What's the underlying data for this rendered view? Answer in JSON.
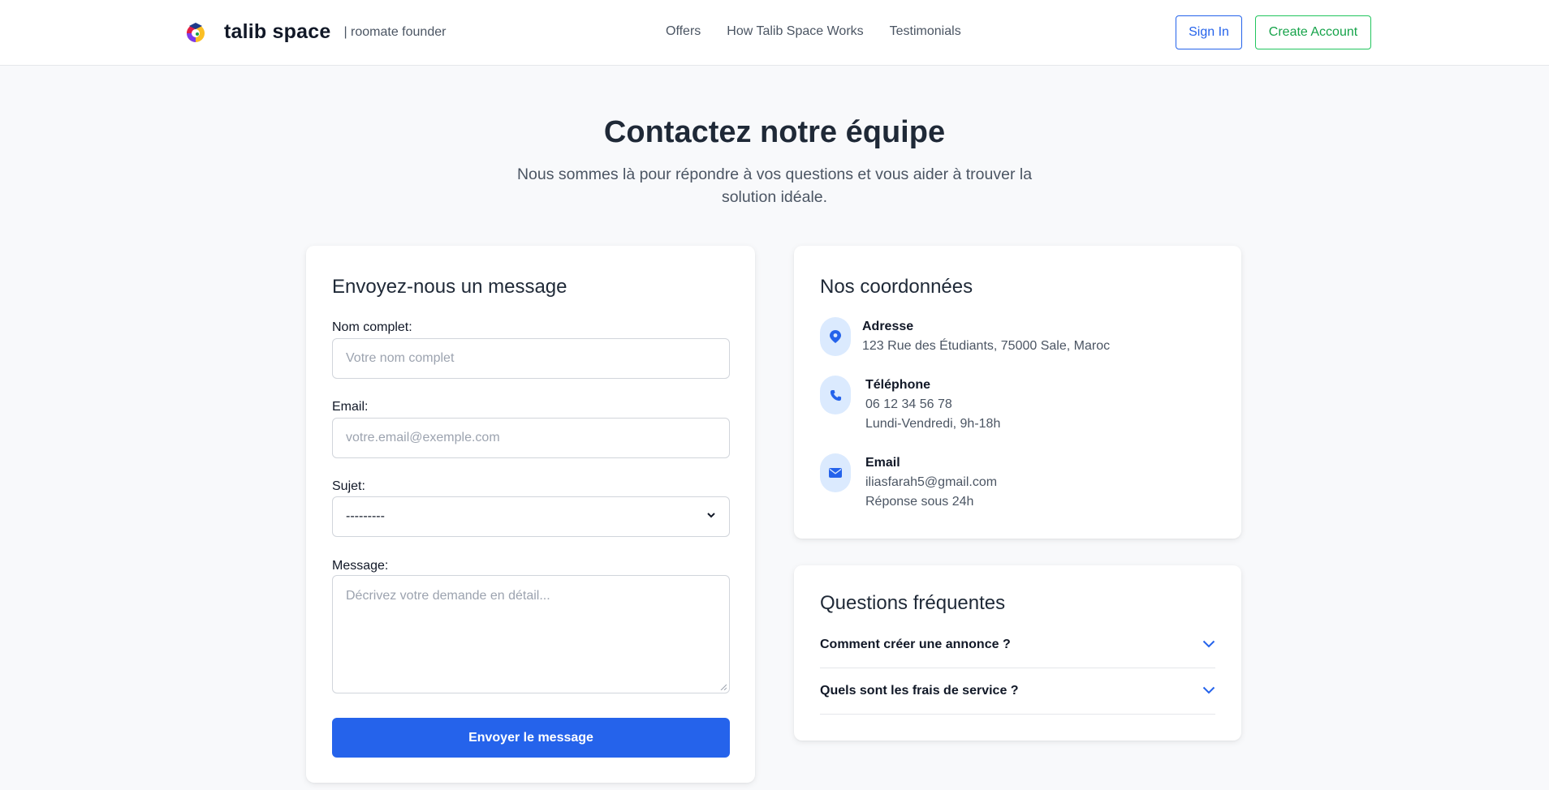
{
  "header": {
    "brand_name": "talib space",
    "brand_tag": "| roomate founder",
    "nav": [
      {
        "label": "Offers"
      },
      {
        "label": "How Talib Space Works"
      },
      {
        "label": "Testimonials"
      }
    ],
    "signin_label": "Sign In",
    "create_label": "Create Account",
    "colors": {
      "signin": "#2563eb",
      "create": "#22c55e"
    }
  },
  "hero": {
    "title": "Contactez notre équipe",
    "subtitle": "Nous sommes là pour répondre à vos questions et vous aider à trouver la solution idéale."
  },
  "form": {
    "title": "Envoyez-nous un message",
    "name_label": "Nom complet:",
    "name_placeholder": "Votre nom complet",
    "email_label": "Email:",
    "email_placeholder": "votre.email@exemple.com",
    "subject_label": "Sujet:",
    "subject_value": "---------",
    "message_label": "Message:",
    "message_placeholder": "Décrivez votre demande en détail...",
    "submit_label": "Envoyer le message",
    "accent": "#2563eb"
  },
  "coords": {
    "title": "Nos coordonnées",
    "items": [
      {
        "icon": "location-pin-icon",
        "title": "Adresse",
        "lines": [
          "123 Rue des Étudiants, 75000 Sale, Maroc"
        ]
      },
      {
        "icon": "phone-icon",
        "title": "Téléphone",
        "lines": [
          "06 12 34 56 78",
          "Lundi-Vendredi, 9h-18h"
        ]
      },
      {
        "icon": "envelope-icon",
        "title": "Email",
        "lines": [
          "iliasfarah5@gmail.com",
          "Réponse sous 24h"
        ]
      }
    ]
  },
  "faq": {
    "title": "Questions fréquentes",
    "items": [
      {
        "question": "Comment créer une annonce ?"
      },
      {
        "question": "Quels sont les frais de service ?"
      }
    ]
  }
}
